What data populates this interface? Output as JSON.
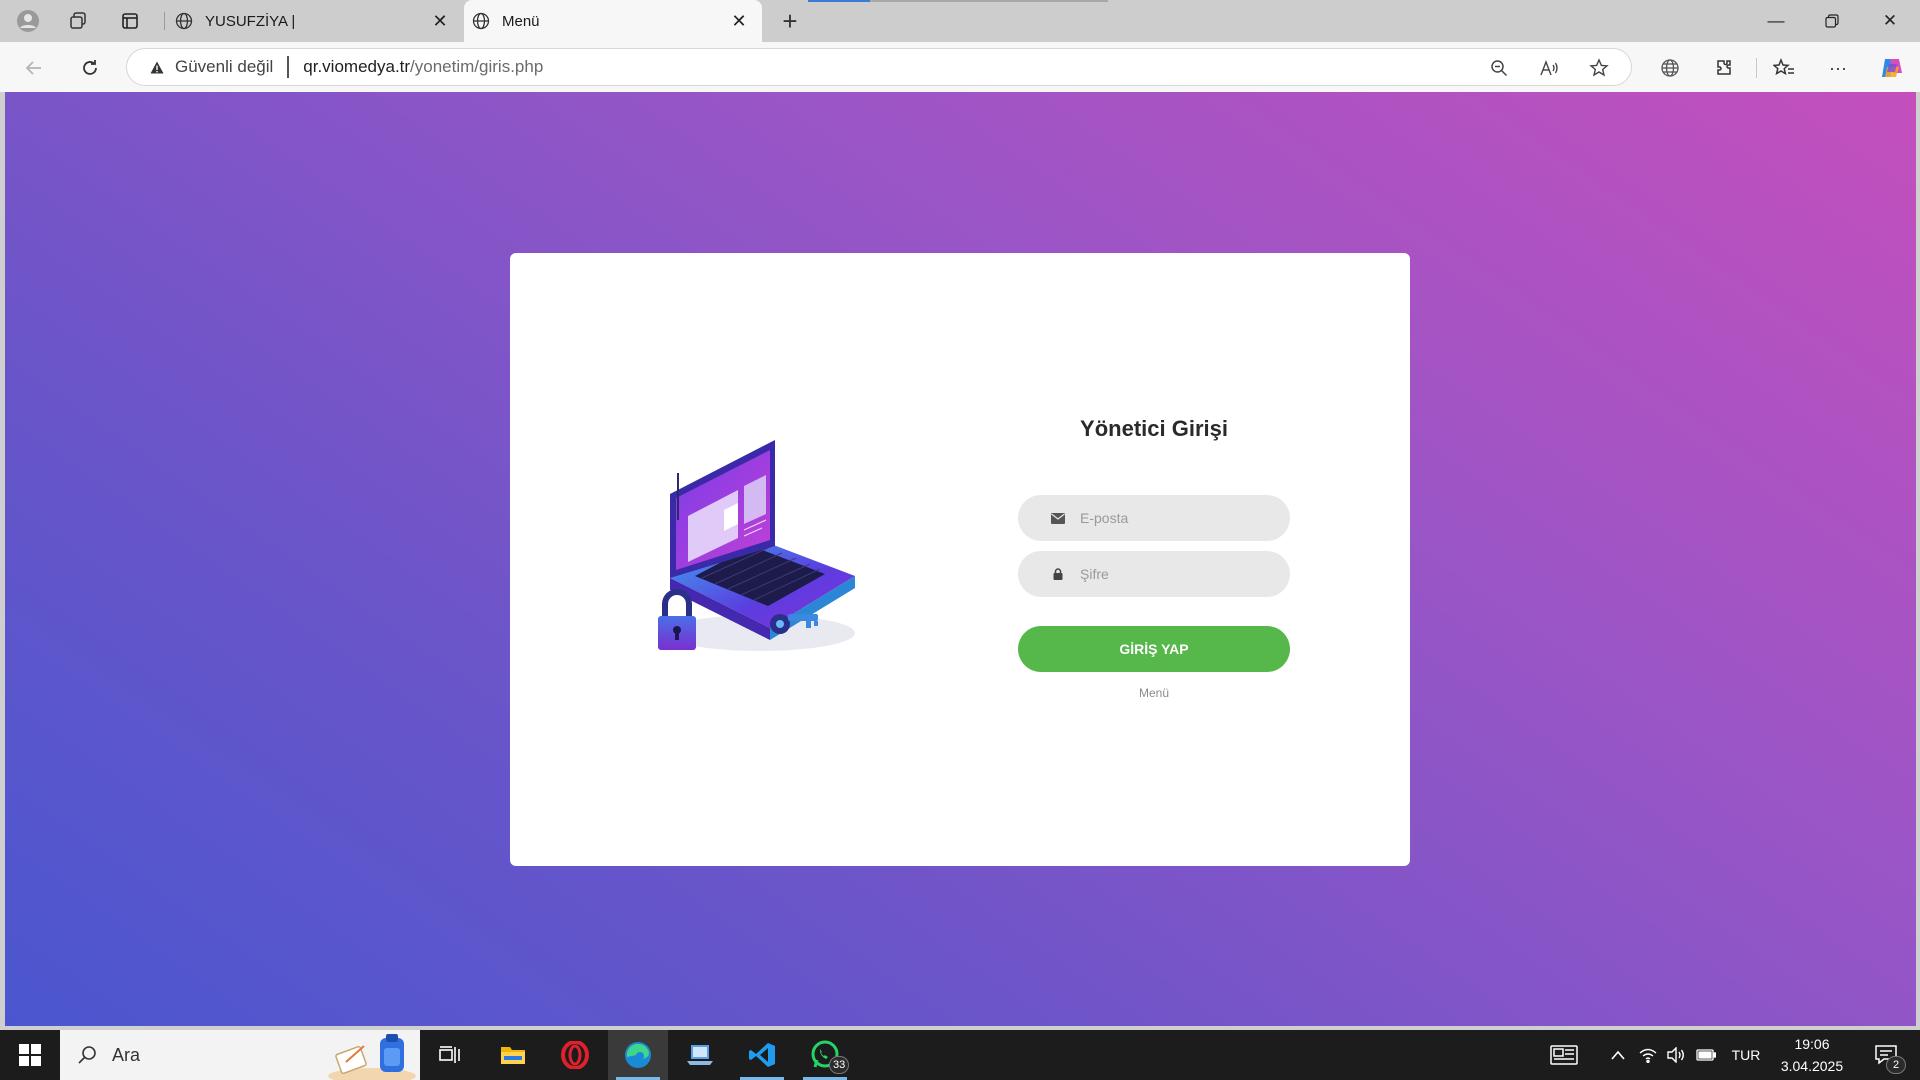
{
  "browser": {
    "tabs": [
      {
        "title": "YUSUFZİYA |"
      },
      {
        "title": "Menü"
      }
    ],
    "security_label": "Güvenli değil",
    "url_host": "qr.viomedya.tr",
    "url_path": "/yonetim/giris.php"
  },
  "login": {
    "title": "Yönetici Girişi",
    "email_placeholder": "E-posta",
    "password_placeholder": "Şifre",
    "submit_label": "GİRİŞ YAP",
    "menu_link": "Menü"
  },
  "taskbar": {
    "search_placeholder": "Ara",
    "whatsapp_badge": "33",
    "language": "TUR",
    "time": "19:06",
    "date": "3.04.2025",
    "notification_count": "2"
  },
  "colors": {
    "gradient_start": "#4a56cf",
    "gradient_end": "#c44fbd",
    "login_button": "#56b74a",
    "card_background": "#ffffff"
  }
}
